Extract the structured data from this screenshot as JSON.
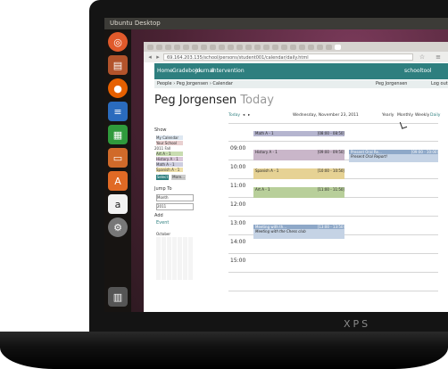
{
  "os": {
    "title": "Ubuntu Desktop"
  },
  "launcher": {
    "icons": [
      "ubuntu-logo-icon",
      "files-icon",
      "firefox-icon",
      "writer-icon",
      "calc-icon",
      "impress-icon",
      "software-center-icon",
      "amazon-icon",
      "settings-icon",
      "trash-icon"
    ]
  },
  "browser": {
    "url": "69.164.203.135/school/persons/student001/calendar/daily.html"
  },
  "schooltool": {
    "nav": [
      "Home",
      "Gradebook",
      "Journal",
      "Intervention"
    ],
    "logo": "schooltool",
    "breadcrumb": "People › Peg Jorgensen › Calendar",
    "user": "Peg Jorgensen",
    "logout": "Log out",
    "person_name": "Peg Jorgensen",
    "today_heading": "Today",
    "date": "Wednesday, November 23, 2011",
    "today_btn": "Today",
    "views": [
      "Yearly",
      "Monthly",
      "Weekly",
      "Daily"
    ],
    "show_label": "Show",
    "calendars": [
      "My Calendar",
      "Your School",
      "2011 Fall",
      "Art A - 1",
      "History A - 1",
      "Math A - 1",
      "Spanish A - 1"
    ],
    "select_btn": "Select",
    "more_btn": "More...",
    "jump_label": "Jump To",
    "month_select": "Month",
    "year_select": "2011",
    "add_label": "Add",
    "event_link": "Event",
    "mini_cal_title": "October",
    "hours": [
      "09:00",
      "10:00",
      "11:00",
      "12:00",
      "13:00",
      "14:00",
      "15:00"
    ],
    "events": [
      {
        "title": "Math A - 1",
        "time": "[08:00 - 08:50]",
        "color": "#b5b5cf"
      },
      {
        "title": "History A - 1",
        "time": "[09:00 - 09:50]",
        "color": "#c9b6c9"
      },
      {
        "title": "Present Oral Re...",
        "time": "[09:00 - 10:00]",
        "color": "#8ea8c8"
      },
      {
        "title": "Present Oral Report!",
        "time": "",
        "color": "#c5d3e5"
      },
      {
        "title": "Spanish A - 1",
        "time": "[10:00 - 10:50]",
        "color": "#e6d294"
      },
      {
        "title": "Art A - 1",
        "time": "[11:00 - 11:50]",
        "color": "#b8cf9a"
      },
      {
        "title": "Meeting with th...",
        "time": "[13:00 - 13:50]",
        "color": "#8ea8c8"
      },
      {
        "title": "Meeting with the Chess club",
        "time": "",
        "color": "#c5d3e5"
      }
    ]
  },
  "laptop": {
    "brand": "XPS"
  }
}
